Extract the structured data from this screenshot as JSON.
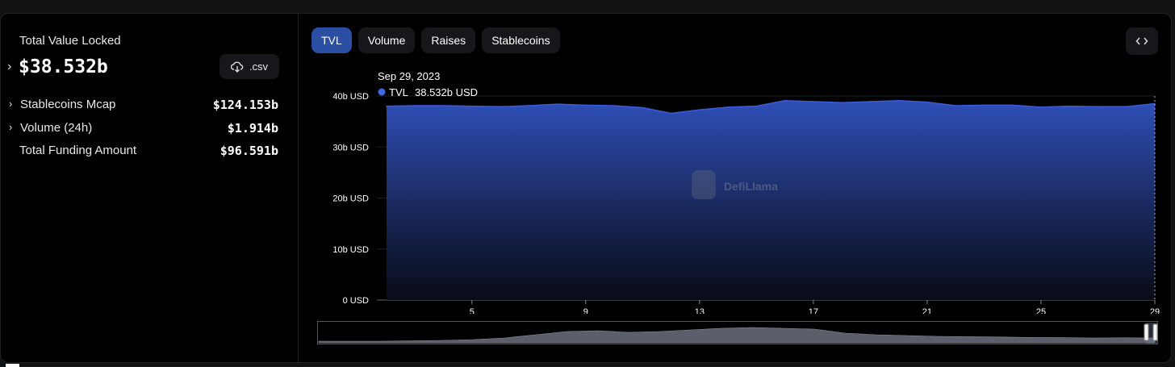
{
  "summary": {
    "tvl_label": "Total Value Locked",
    "tvl_value": "$38.532b",
    "csv_label": ".csv",
    "rows": [
      {
        "label": "Stablecoins Mcap",
        "value": "$124.153b"
      },
      {
        "label": "Volume (24h)",
        "value": "$1.914b"
      },
      {
        "label": "Total Funding Amount",
        "value": "$96.591b"
      }
    ]
  },
  "tabs": [
    "TVL",
    "Volume",
    "Raises",
    "Stablecoins"
  ],
  "active_tab": "TVL",
  "tooltip": {
    "date": "Sep 29, 2023",
    "series": "TVL",
    "value": "38.532b USD"
  },
  "watermark": "DefiLlama",
  "colors": {
    "accent": "#2b4fa3",
    "series": "#3b5bdb",
    "area_top": "#2f4fb8",
    "marker": "#4169e1"
  },
  "icons": {
    "csv": "cloud-download-icon",
    "embed": "code-icon",
    "expand": "chevron-right-icon"
  },
  "chart_data": {
    "type": "area",
    "series": [
      {
        "name": "TVL",
        "values": [
          38.0,
          38.1,
          38.1,
          38.0,
          37.9,
          38.1,
          38.4,
          38.2,
          38.1,
          37.7,
          36.6,
          37.3,
          37.8,
          38.0,
          39.1,
          38.9,
          38.7,
          38.9,
          39.1,
          38.8,
          38.1,
          38.2,
          38.2,
          37.8,
          38.0,
          37.9,
          37.9,
          38.5
        ]
      }
    ],
    "x": [
      2,
      3,
      4,
      5,
      6,
      7,
      8,
      9,
      10,
      11,
      12,
      13,
      14,
      15,
      16,
      17,
      18,
      19,
      20,
      21,
      22,
      23,
      24,
      25,
      26,
      27,
      28,
      29
    ],
    "x_ticks": [
      5,
      9,
      13,
      17,
      21,
      25,
      29
    ],
    "y_ticks": [
      "0 USD",
      "10b USD",
      "20b USD",
      "30b USD",
      "40b USD"
    ],
    "y_tick_values": [
      0,
      10,
      20,
      30,
      40
    ],
    "ylim": [
      0,
      40
    ],
    "xlim": [
      2,
      29
    ],
    "grid": true,
    "navigator_values": [
      0.1,
      0.1,
      0.1,
      0.12,
      0.15,
      0.2,
      0.3,
      0.5,
      0.7,
      0.75,
      0.65,
      0.7,
      0.8,
      0.9,
      0.95,
      0.9,
      0.85,
      0.6,
      0.5,
      0.45,
      0.4,
      0.38,
      0.36,
      0.33,
      0.32,
      0.3,
      0.31,
      0.3
    ]
  }
}
